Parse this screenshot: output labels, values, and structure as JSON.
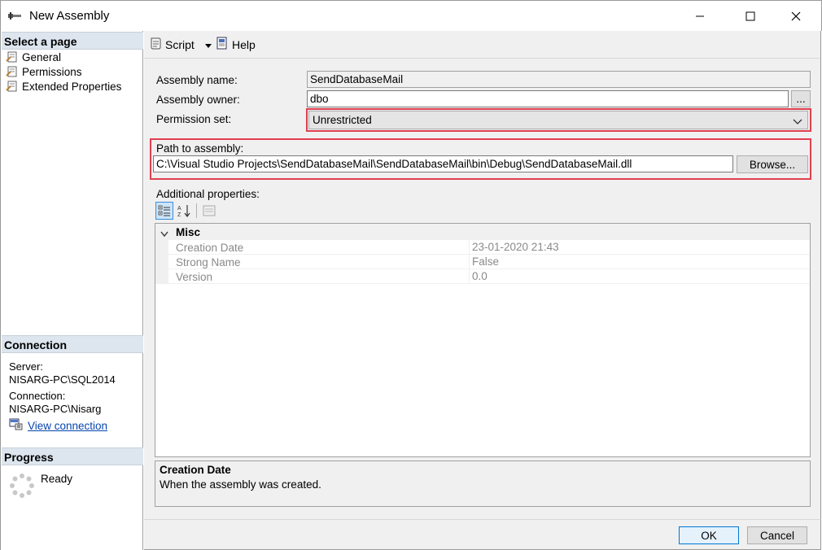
{
  "window": {
    "title": "New Assembly",
    "controls": [
      "minimize",
      "maximize",
      "close"
    ]
  },
  "left_pane": {
    "select_page_header": "Select a page",
    "pages": [
      {
        "label": "General",
        "icon": "page-wrench-icon"
      },
      {
        "label": "Permissions",
        "icon": "page-wrench-icon"
      },
      {
        "label": "Extended Properties",
        "icon": "page-wrench-icon"
      }
    ],
    "connection_header": "Connection",
    "server_label": "Server:",
    "server_value": "NISARG-PC\\SQL2014",
    "connection_label": "Connection:",
    "connection_value": "NISARG-PC\\Nisarg",
    "view_connection": "View connection",
    "progress_header": "Progress",
    "progress_status": "Ready"
  },
  "toolbar": {
    "script_label": "Script",
    "help_label": "Help"
  },
  "form": {
    "assembly_name_label": "Assembly name:",
    "assembly_name_value": "SendDatabaseMail",
    "assembly_owner_label": "Assembly owner:",
    "assembly_owner_value": "dbo",
    "owner_browse": "...",
    "permission_set_label": "Permission set:",
    "permission_set_value": "Unrestricted",
    "path_label": "Path to assembly:",
    "path_value": "C:\\Visual Studio Projects\\SendDatabaseMail\\SendDatabaseMail\\bin\\Debug\\SendDatabaseMail.dll",
    "browse_button": "Browse...",
    "additional_properties_label": "Additional properties:"
  },
  "property_grid": {
    "category": "Misc",
    "rows": [
      {
        "name": "Creation Date",
        "value": "23-01-2020 21:43"
      },
      {
        "name": "Strong Name",
        "value": "False"
      },
      {
        "name": "Version",
        "value": "0.0"
      }
    ],
    "description_title": "Creation Date",
    "description_text": "When the assembly was created."
  },
  "footer": {
    "ok_label": "OK",
    "cancel_label": "Cancel"
  },
  "colors": {
    "highlight_border": "#e04050",
    "pane_header_bg": "#dde5ee",
    "link": "#0645ad"
  }
}
